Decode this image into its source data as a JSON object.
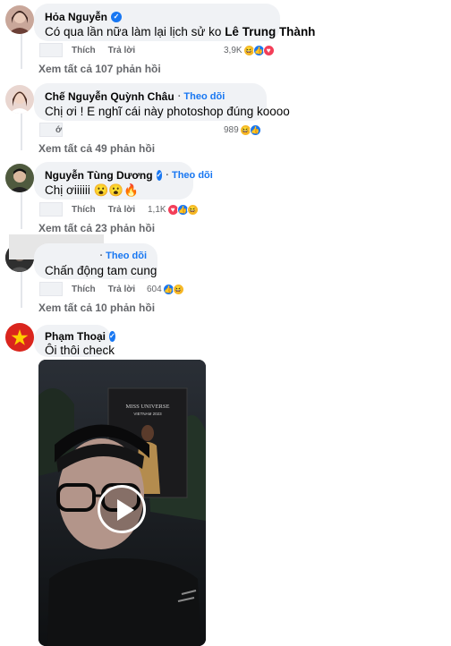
{
  "actions": {
    "like": "Thích",
    "reply": "Trả lời",
    "follow": "Theo dõi"
  },
  "comments": [
    {
      "author": "Hỏa Nguyễn",
      "text": "Có qua lần nữa làm lại lịch sử ko",
      "mention": "Lê Trung Thành",
      "reaction_count": "3,9K",
      "view_replies": "Xem tất cả 107 phản hồi"
    },
    {
      "author": "Chế Nguyễn Quỳnh Châu",
      "text": "Chị ơi ! E nghĩ cái này photoshop đúng koooo",
      "reaction_count": "989",
      "view_replies": "Xem tất cả 49 phản hồi",
      "partial_action": "ớ"
    },
    {
      "author": "Nguyễn Tùng Dương",
      "text": "Chị ơiiiiii 😮😮🔥",
      "reaction_count": "1,1K",
      "view_replies": "Xem tất cả 23 phản hồi"
    },
    {
      "author": "",
      "text": "Chấn động tam cung",
      "reaction_count": "604",
      "view_replies": "Xem tất cả 10 phản hồi"
    },
    {
      "author": "Phạm Thoại",
      "text": "Ôi thôi check"
    }
  ],
  "video": {
    "poster_lines": [
      "MISS UNIVERSE",
      "VIETNAM 2023"
    ],
    "icon": "play-icon"
  },
  "colors": {
    "link_blue": "#1877f2",
    "bubble_bg": "#f0f2f5",
    "muted_text": "#65676b"
  }
}
